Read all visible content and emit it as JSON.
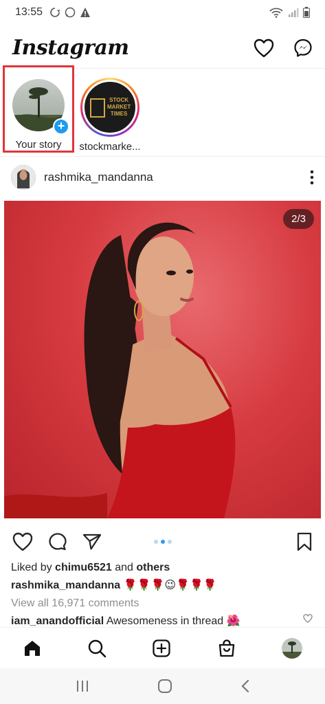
{
  "status_bar": {
    "time": "13:55"
  },
  "header": {
    "logo": "Instagram"
  },
  "stories": [
    {
      "label": "Your story"
    },
    {
      "label": "stockmarke...",
      "logo_text": [
        "STOCK",
        "MARKET",
        "TIMES"
      ]
    }
  ],
  "post": {
    "username": "rashmika_mandanna",
    "image_counter": "2/3",
    "liked_by_prefix": "Liked by ",
    "liked_by_user": "chimu6521",
    "liked_by_and": " and ",
    "liked_by_others": "others",
    "caption_user": "rashmika_mandanna",
    "caption_text": " 🌹🌹🌹😉🌹🌹🌹",
    "view_comments": "View all 16,971 comments",
    "comment_user": "iam_anandofficial",
    "comment_text": " Awesomeness in thread 🌺"
  },
  "colors": {
    "accent_blue": "#1d9bf0",
    "highlight_red": "#e0343a",
    "post_bg": "#d63b41"
  }
}
